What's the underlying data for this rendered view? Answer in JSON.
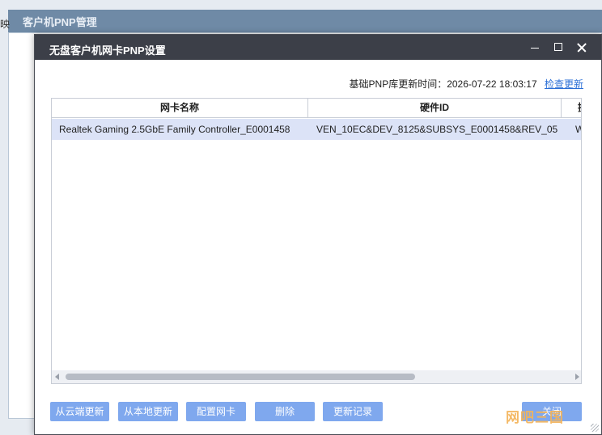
{
  "background_window": {
    "title": "客户机PNP管理",
    "side_text": "映"
  },
  "dialog": {
    "title": "无盘客户机网卡PNP设置",
    "update_label": "基础PNP库更新时间：2026-07-22 18:03:17",
    "update_link": "检查更新",
    "table": {
      "columns": [
        "网卡名称",
        "硬件ID",
        "操"
      ],
      "rows": [
        {
          "name": "Realtek Gaming 2.5GbE Family Controller_E0001458",
          "hwid": "VEN_10EC&DEV_8125&SUBSYS_E0001458&REV_05",
          "extra": "W"
        }
      ]
    },
    "buttons": {
      "cloud_update": "从云端更新",
      "local_update": "从本地更新",
      "config_nic": "配置网卡",
      "delete": "删除",
      "update_log": "更新记录",
      "close": "关闭"
    },
    "watermark": "网吧三国"
  },
  "colors": {
    "dialog_titlebar": "#3c3f48",
    "button": "#7fa8ee",
    "selected_row": "#dce3f7",
    "link": "#2b6fd6"
  }
}
